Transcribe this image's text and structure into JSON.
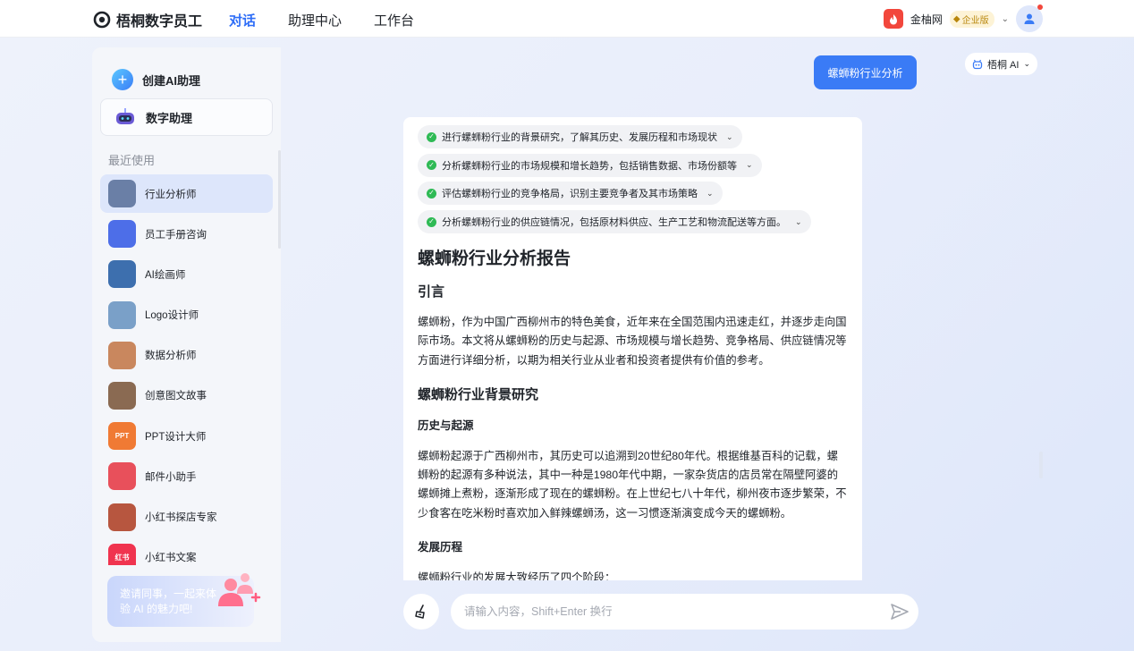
{
  "app": {
    "name": "梧桐数字员工",
    "nav": [
      "对话",
      "助理中心",
      "工作台"
    ],
    "active_nav": "对话"
  },
  "account": {
    "org_name": "金柚网",
    "edition_badge": "企业版"
  },
  "sidebar": {
    "create_label": "创建AI助理",
    "digital_label": "数字助理",
    "recent_title": "最近使用",
    "agents": [
      {
        "label": "行业分析师",
        "active": true,
        "color": "#6a7fa6"
      },
      {
        "label": "员工手册咨询",
        "active": false,
        "color": "#4d6ee8"
      },
      {
        "label": "AI绘画师",
        "active": false,
        "color": "#3d6fae"
      },
      {
        "label": "Logo设计师",
        "active": false,
        "color": "#7aa0c8"
      },
      {
        "label": "数据分析师",
        "active": false,
        "color": "#c9875e"
      },
      {
        "label": "创意图文故事",
        "active": false,
        "color": "#8a6a52"
      },
      {
        "label": "PPT设计大师",
        "active": false,
        "color": "#f07a34",
        "icon_text": "PPT"
      },
      {
        "label": "邮件小助手",
        "active": false,
        "color": "#e8505b"
      },
      {
        "label": "小红书探店专家",
        "active": false,
        "color": "#b7563f"
      },
      {
        "label": "小红书文案",
        "active": false,
        "color": "#f0344f",
        "icon_text": "红书"
      }
    ],
    "invite_text": "邀请同事，一起来体验 AI 的魅力吧!"
  },
  "chat": {
    "user_message": "螺蛳粉行业分析",
    "model_name": "梧桐 AI",
    "steps": [
      "进行螺蛳粉行业的背景研究，了解其历史、发展历程和市场现状",
      "分析螺蛳粉行业的市场规模和增长趋势，包括销售数据、市场份额等",
      "评估螺蛳粉行业的竞争格局，识别主要竞争者及其市场策略",
      "分析螺蛳粉行业的供应链情况，包括原材料供应、生产工艺和物流配送等方面。"
    ],
    "report": {
      "title": "螺蛳粉行业分析报告",
      "intro_heading": "引言",
      "intro_text": "螺蛳粉，作为中国广西柳州市的特色美食，近年来在全国范围内迅速走红，并逐步走向国际市场。本文将从螺蛳粉的历史与起源、市场规模与增长趋势、竞争格局、供应链情况等方面进行详细分析，以期为相关行业从业者和投资者提供有价值的参考。",
      "background_heading": "螺蛳粉行业背景研究",
      "history_heading": "历史与起源",
      "history_text": "螺蛳粉起源于广西柳州市，其历史可以追溯到20世纪80年代。根据维基百科的记载，螺蛳粉的起源有多种说法，其中一种是1980年代中期，一家杂货店的店员常在隔壁阿婆的螺蛳摊上煮粉，逐渐形成了现在的螺蛳粉。在上世纪七八十年代，柳州夜市逐步繁荣，不少食客在吃米粉时喜欢加入鲜辣螺蛳汤，这一习惯逐渐演变成今天的螺蛳粉。",
      "development_heading": "发展历程",
      "development_text": "螺蛳粉行业的发展大致经历了四个阶段："
    },
    "input_placeholder": "请输入内容，Shift+Enter 换行"
  },
  "colors": {
    "accent": "#2f6ef7",
    "user_bubble": "#3a7bf6",
    "check": "#2fba55"
  }
}
